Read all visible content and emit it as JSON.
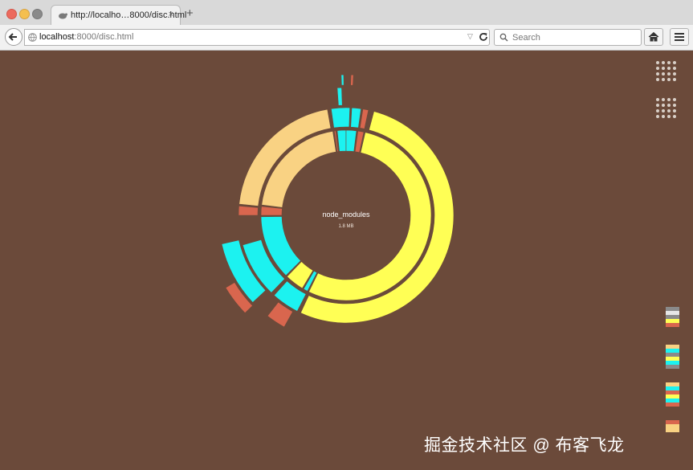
{
  "browser": {
    "tab_title": "http://localho…8000/disc.html",
    "tab_close_glyph": "×",
    "new_tab_glyph": "+",
    "url_host": "localhost",
    "url_rest": ":8000/disc.html",
    "url_dropdown_glyph": "▽",
    "search_placeholder": "Search"
  },
  "chart_data": {
    "type": "sunburst",
    "center_label": "node_modules",
    "center_size": "1.8 MB",
    "colors": {
      "background": "#6b4a3a",
      "yellow": "#ffff55",
      "peach": "#f9d283",
      "cyan": "#1cf2f0",
      "coral": "#d9664e"
    }
  },
  "palettes": [
    [
      "#8a8a8a",
      "#e6e6e6",
      "#8a8a8a",
      "#ffff55",
      "#d9664e"
    ],
    [
      "#f9d283",
      "#1cf2f0",
      "#8a8a8a",
      "#ffff55",
      "#1cf2f0",
      "#8a8a8a"
    ],
    [
      "#f9d283",
      "#1cf2f0",
      "#d9664e",
      "#ffff55",
      "#1cf2f0",
      "#d9664e"
    ],
    [
      "#d9664e",
      "#f9d283",
      "#f9d283"
    ]
  ],
  "watermark": "掘金技术社区 @ 布客飞龙"
}
